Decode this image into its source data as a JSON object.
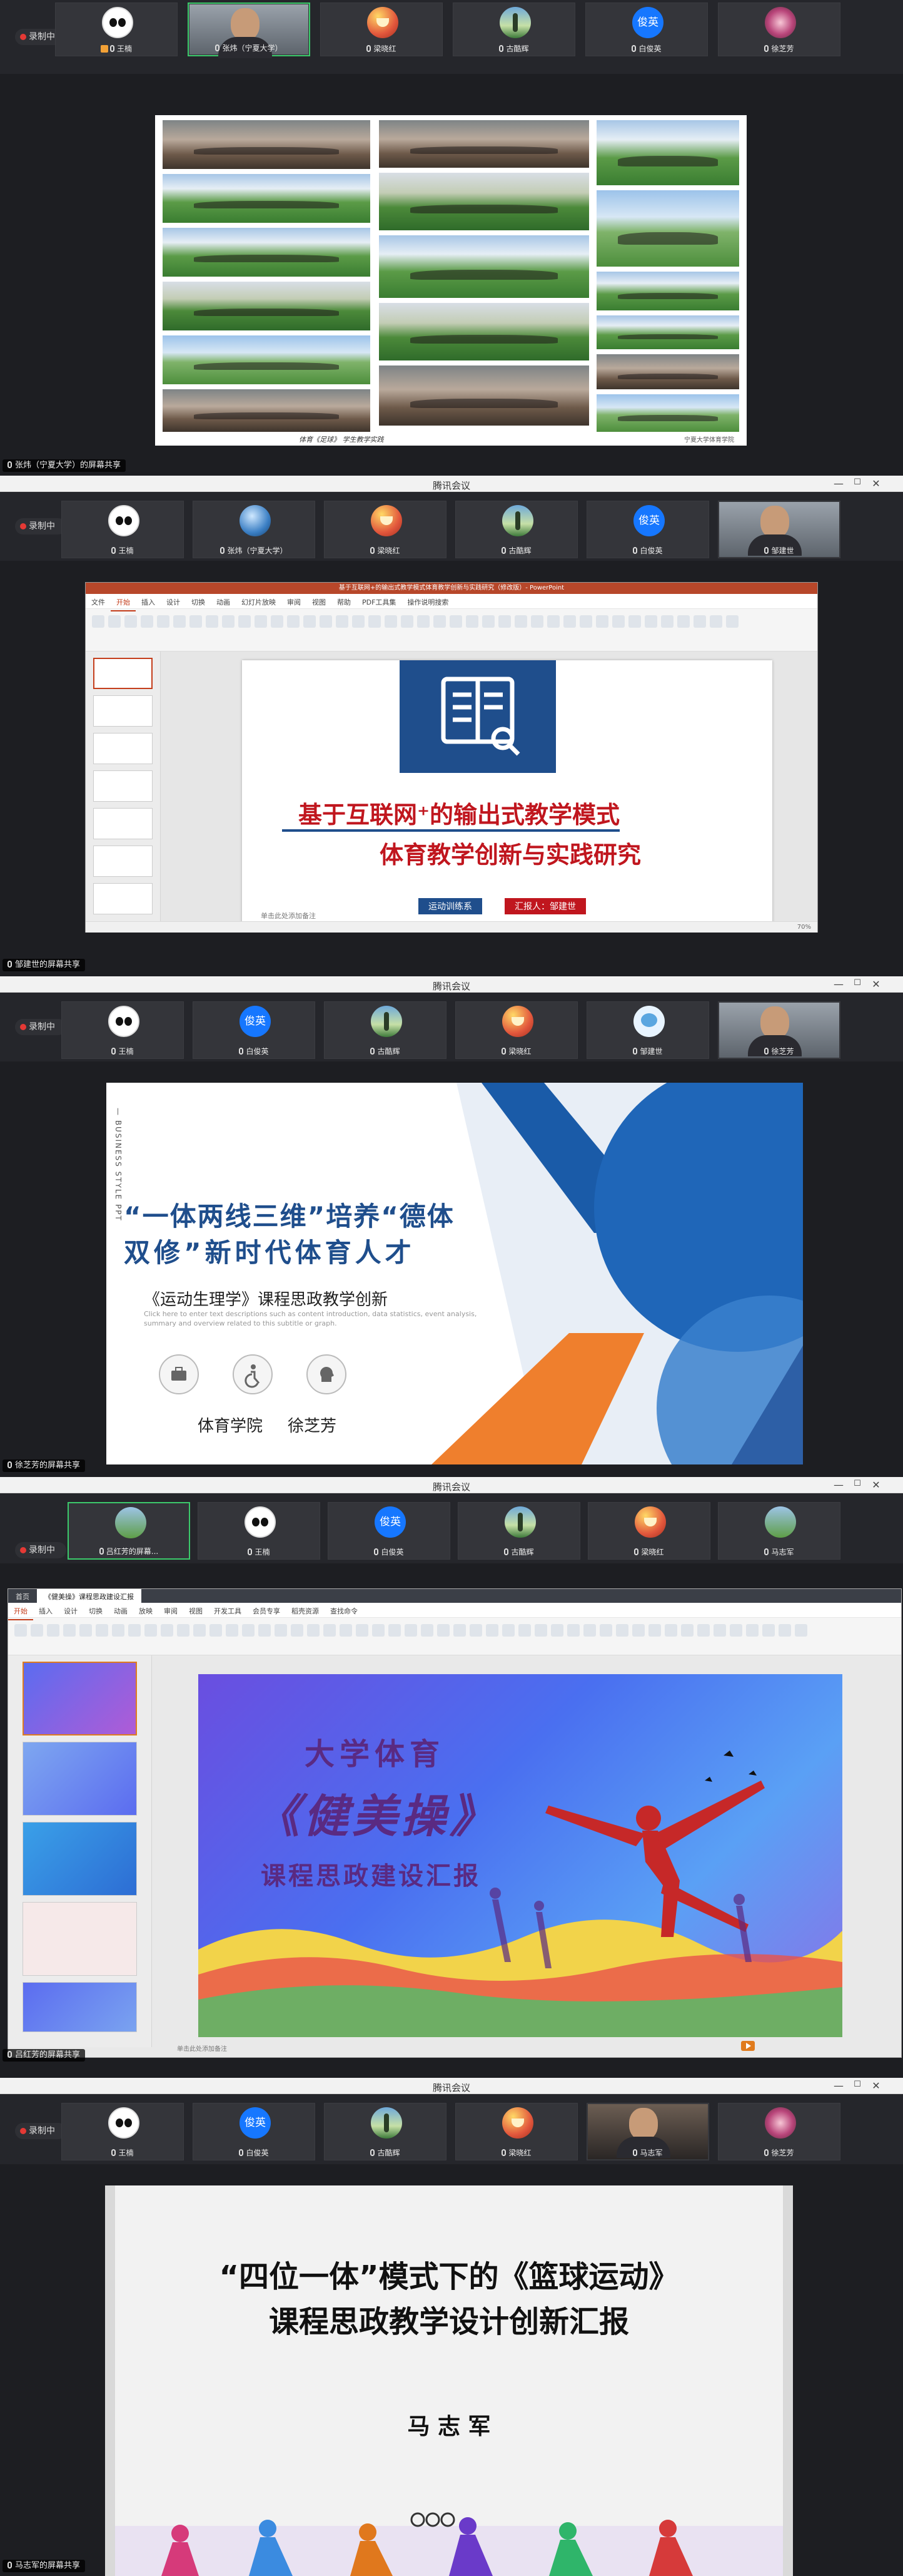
{
  "app_title": "腾讯会议",
  "window_controls": [
    "—",
    "☐",
    "□",
    "✕"
  ],
  "recording_label": "录制中",
  "sessions": [
    {
      "participants": [
        {
          "name": "王楠",
          "avatar": "panda-icon",
          "host": true
        },
        {
          "name": "张炜（宁夏大学）",
          "avatar": "camera-feed",
          "active": true
        },
        {
          "name": "梁晓红",
          "avatar": "cartoon-icon"
        },
        {
          "name": "古酷辉",
          "avatar": "landscape-icon"
        },
        {
          "name": "白俊英",
          "avatar": "text-avatar",
          "avatar_text": "俊英"
        },
        {
          "name": "徐芝芳",
          "avatar": "flower-icon"
        }
      ],
      "share_label": "张炜（宁夏大学）的屏幕共享",
      "slide": {
        "caption": "体育《足球》 学生教学实践",
        "footer_right": "宁夏大学体育学院",
        "photo_count": 17
      }
    },
    {
      "participants": [
        {
          "name": "王楠",
          "avatar": "panda-icon"
        },
        {
          "name": "张炜（宁夏大学）",
          "avatar": "globe-icon"
        },
        {
          "name": "梁晓红",
          "avatar": "cartoon-icon"
        },
        {
          "name": "古酷辉",
          "avatar": "landscape-icon"
        },
        {
          "name": "白俊英",
          "avatar": "text-avatar",
          "avatar_text": "俊英"
        },
        {
          "name": "邹建世",
          "avatar": "camera-feed"
        }
      ],
      "share_label": "邹建世的屏幕共享",
      "ppt": {
        "window_title": "基于互联网+的输出式教学模式体育教学创新与实践研究（修改版）- PowerPoint",
        "tabs": [
          "文件",
          "开始",
          "插入",
          "设计",
          "切换",
          "动画",
          "幻灯片放映",
          "审阅",
          "视图",
          "帮助",
          "PDF工具集",
          "操作说明搜索"
        ],
        "active_tab": "开始",
        "title_line1": "基于互联网⁺的输出式教学模式",
        "title_line2": "体育教学创新与实践研究",
        "tag_left": "运动训练系",
        "tag_right": "汇报人：邹建世",
        "notes_placeholder": "单击此处添加备注",
        "zoom": "70%"
      }
    },
    {
      "participants": [
        {
          "name": "王楠",
          "avatar": "panda-icon"
        },
        {
          "name": "白俊英",
          "avatar": "text-avatar",
          "avatar_text": "俊英"
        },
        {
          "name": "古酷辉",
          "avatar": "landscape-icon"
        },
        {
          "name": "梁晓红",
          "avatar": "cartoon-icon"
        },
        {
          "name": "邹建世",
          "avatar": "bird-icon"
        },
        {
          "name": "徐芝芳",
          "avatar": "camera-feed"
        }
      ],
      "share_label": "徐芝芳的屏幕共享",
      "slide": {
        "side_text": "— BUSINESS STYLE PPT",
        "title_line1": "“一体两线三维”培养“德体",
        "title_line2": "双修”新时代体育人才",
        "subtitle": "《运动生理学》课程思政教学创新",
        "placeholder": "Click here to enter text descriptions such as content introduction, data statistics, event analysis, summary and overview related to this subtitle or graph.",
        "presenter_org": "体育学院",
        "presenter_name": "徐芝芳"
      }
    },
    {
      "participants": [
        {
          "name": "吕红芳的屏幕...",
          "avatar": "tree-icon",
          "active": true
        },
        {
          "name": "王楠",
          "avatar": "panda-icon"
        },
        {
          "name": "白俊英",
          "avatar": "text-avatar",
          "avatar_text": "俊英"
        },
        {
          "name": "古酷辉",
          "avatar": "landscape-icon"
        },
        {
          "name": "梁晓红",
          "avatar": "cartoon-icon"
        },
        {
          "name": "马志军",
          "avatar": "tree-icon"
        }
      ],
      "share_label": "吕红芳的屏幕共享",
      "wps": {
        "doc_tab": "《健美操》课程思政建设汇报",
        "home_tab": "首页",
        "tabs": [
          "开始",
          "插入",
          "设计",
          "切换",
          "动画",
          "放映",
          "审阅",
          "视图",
          "开发工具",
          "会员专享",
          "稻壳资源",
          "查找命令"
        ],
        "title1": "大学体育",
        "title2": "《健美操》",
        "title3": "课程思政建设汇报",
        "notes_placeholder": "单击此处添加备注"
      }
    },
    {
      "participants": [
        {
          "name": "王楠",
          "avatar": "panda-icon"
        },
        {
          "name": "白俊英",
          "avatar": "text-avatar",
          "avatar_text": "俊英"
        },
        {
          "name": "古酷辉",
          "avatar": "landscape-icon"
        },
        {
          "name": "梁晓红",
          "avatar": "cartoon-icon"
        },
        {
          "name": "马志军",
          "avatar": "camera-feed"
        },
        {
          "name": "徐芝芳",
          "avatar": "flower-icon"
        }
      ],
      "share_label": "马志军的屏幕共享",
      "slide": {
        "title_line1": "“四位一体”模式下的《篮球运动》",
        "title_line2": "课程思政教学设计创新汇报",
        "presenter": "马 志 军"
      }
    }
  ]
}
